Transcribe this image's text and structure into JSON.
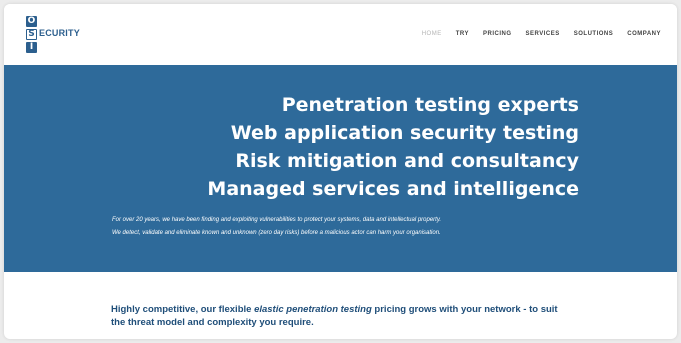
{
  "logo": {
    "letter_top": "O",
    "letter_mid": "S",
    "letter_bottom": "I",
    "wordmark": "ECURITY"
  },
  "nav": {
    "items": [
      {
        "label": "HOME",
        "active": true
      },
      {
        "label": "TRY"
      },
      {
        "label": "PRICING"
      },
      {
        "label": "SERVICES"
      },
      {
        "label": "SOLUTIONS"
      },
      {
        "label": "COMPANY"
      }
    ]
  },
  "hero": {
    "headlines": [
      "Penetration testing experts",
      "Web application security testing",
      "Risk mitigation and consultancy",
      "Managed services and intelligence"
    ],
    "intro_lines": [
      "For over 20 years, we have been finding and exploiting vulnerabilities to protect your systems, data and intellectual property.",
      "We detect, validate and eliminate known and unknown (zero day risks) before a malicious actor can harm your organisation."
    ]
  },
  "tagline": {
    "before": "Highly competitive, our flexible ",
    "emphasis": "elastic penetration testing",
    "after": " pricing grows with your network - to suit the threat model and complexity you require."
  },
  "colors": {
    "brand_blue": "#2c5f8e",
    "hero_background": "#2e6a9a",
    "tagline_text": "#1f4e79"
  }
}
